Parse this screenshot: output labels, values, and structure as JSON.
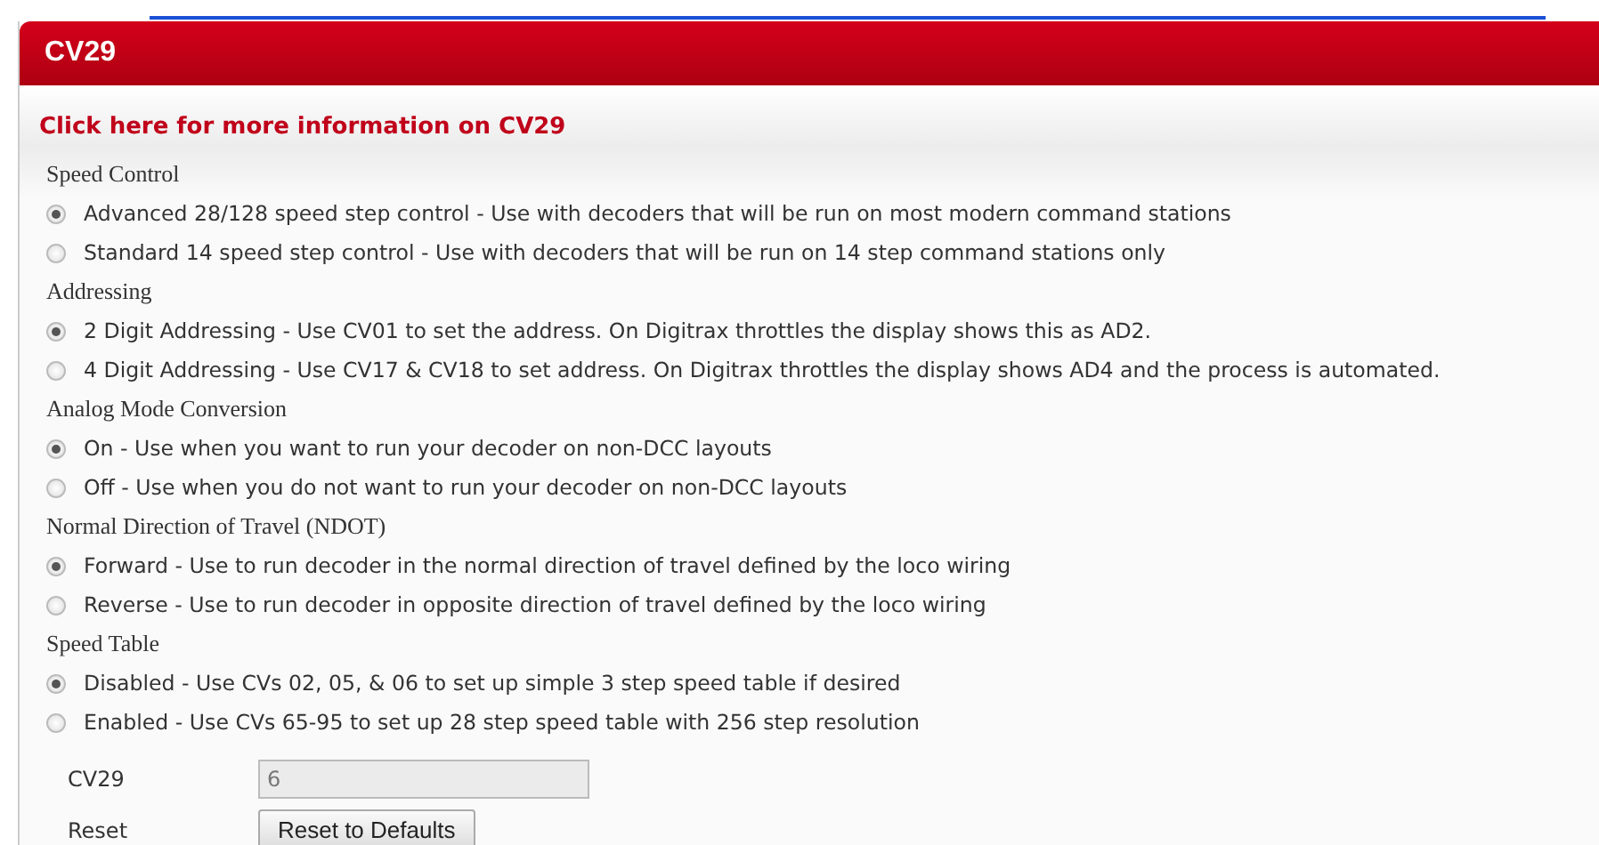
{
  "panel": {
    "title": "CV29",
    "info_link": "Click here for more information on CV29"
  },
  "groups": [
    {
      "heading": "Speed Control",
      "options": [
        {
          "label": "Advanced 28/128 speed step control - Use with decoders that will be run on most modern command stations",
          "selected": true
        },
        {
          "label": "Standard 14 speed step control - Use with decoders that will be run on 14 step command stations only",
          "selected": false
        }
      ]
    },
    {
      "heading": "Addressing",
      "options": [
        {
          "label": "2 Digit Addressing - Use CV01 to set the address. On Digitrax throttles the display shows this as AD2.",
          "selected": true
        },
        {
          "label": "4 Digit Addressing - Use CV17 & CV18 to set address. On Digitrax throttles the display shows AD4 and the process is automated.",
          "selected": false
        }
      ]
    },
    {
      "heading": "Analog Mode Conversion",
      "options": [
        {
          "label": "On - Use when you want to run your decoder on non-DCC layouts",
          "selected": true
        },
        {
          "label": "Off - Use when you do not want to run your decoder on non-DCC layouts",
          "selected": false
        }
      ]
    },
    {
      "heading": "Normal Direction of Travel (NDOT)",
      "options": [
        {
          "label": "Forward - Use to run decoder in the normal direction of travel defined by the loco wiring",
          "selected": true
        },
        {
          "label": "Reverse - Use to run decoder in opposite direction of travel defined by the loco wiring",
          "selected": false
        }
      ]
    },
    {
      "heading": "Speed Table",
      "options": [
        {
          "label": "Disabled - Use CVs 02, 05, & 06 to set up simple 3 step speed table if desired",
          "selected": true
        },
        {
          "label": "Enabled - Use CVs 65-95 to set up 28 step speed table with 256 step resolution",
          "selected": false
        }
      ]
    }
  ],
  "cv29": {
    "label": "CV29",
    "value": "6",
    "disabled": true
  },
  "reset": {
    "label": "Reset",
    "button": "Reset to Defaults"
  }
}
